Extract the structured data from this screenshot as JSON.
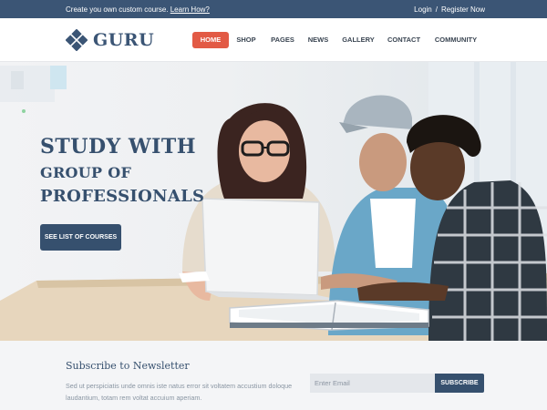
{
  "topbar": {
    "promo_text": "Create you own custom course.",
    "promo_link": "Learn How?",
    "login": "Login",
    "separator": "/",
    "register": "Register Now"
  },
  "header": {
    "logo_text": "GURU",
    "nav": [
      {
        "label": "HOME",
        "active": true
      },
      {
        "label": "SHOP",
        "active": false
      },
      {
        "label": "PAGES",
        "active": false
      },
      {
        "label": "NEWS",
        "active": false
      },
      {
        "label": "GALLERY",
        "active": false
      },
      {
        "label": "CONTACT",
        "active": false
      },
      {
        "label": "COMMUNITY",
        "active": false
      }
    ]
  },
  "hero": {
    "line1": "STUDY WITH",
    "line2": "GROUP OF",
    "line3": "PROFESSIONALS",
    "cta_label": "SEE LIST OF COURSES"
  },
  "newsletter": {
    "title": "Subscribe to Newsletter",
    "text": "Sed ut perspiciatis unde omnis iste natus error sit voltatem accustium doloque laudantium, totam rem voltat accuium aperiam.",
    "email_placeholder": "Enter Email",
    "subscribe_label": "SUBSCRIBE"
  },
  "colors": {
    "brand": "#3b5575",
    "accent": "#e25a45",
    "newsletter_bg": "#f4f5f7"
  },
  "icons": {
    "logo": "diamond-grid-icon"
  }
}
